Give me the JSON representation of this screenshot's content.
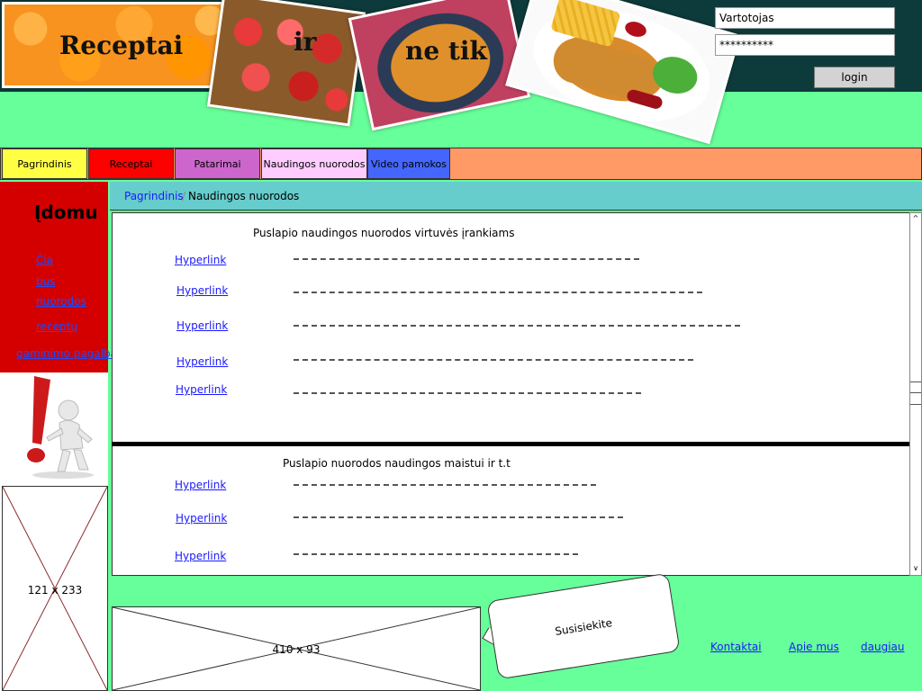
{
  "header": {
    "title_words": [
      "Receptai",
      "ir",
      "ne tik"
    ],
    "login": {
      "username_value": "Vartotojas",
      "password_value": "**********",
      "button_label": "login"
    }
  },
  "nav": {
    "tabs": [
      {
        "label": "Pagrindinis",
        "color": "#ffff44"
      },
      {
        "label": "Receptai",
        "color": "#ff0000"
      },
      {
        "label": "Patarimai",
        "color": "#cc66cc"
      },
      {
        "label": "Naudingos nuorodos",
        "color": "#ffccff"
      },
      {
        "label": "Video pamokos",
        "color": "#4466ff"
      }
    ]
  },
  "sidebar": {
    "title": "Įdomu",
    "links": [
      "Čia",
      "bus",
      "nuorodos",
      "receptų",
      "gaminimo pagalba"
    ],
    "placeholder_label": "121 x 233"
  },
  "breadcrumb": {
    "home": "Pagrindinis",
    "separator": "/",
    "current": "Naudingos nuorodos"
  },
  "content": {
    "section1": {
      "title": "Puslapio naudingos nuorodos virtuvės įrankiams",
      "links": [
        "Hyperlink",
        "Hyperlink",
        "Hyperlink",
        "Hyperlink",
        "Hyperlink"
      ]
    },
    "section2": {
      "title": "Puslapio nuorodos naudingos maistui ir t.t",
      "links": [
        "Hyperlink",
        "Hyperlink",
        "Hyperlink"
      ]
    }
  },
  "footer": {
    "placeholder_label": "410 x 93",
    "contact_bubble": "Susisiekite",
    "links": [
      "Kontaktai",
      "Apie mus",
      "daugiau"
    ]
  },
  "colors": {
    "page_bg": "#66ff99",
    "header_bg": "#0d3b3b",
    "nav_bg": "#ff9966",
    "sidebar_red": "#d40000",
    "breadcrumb_bg": "#66cccc",
    "link": "#1a1aff"
  }
}
